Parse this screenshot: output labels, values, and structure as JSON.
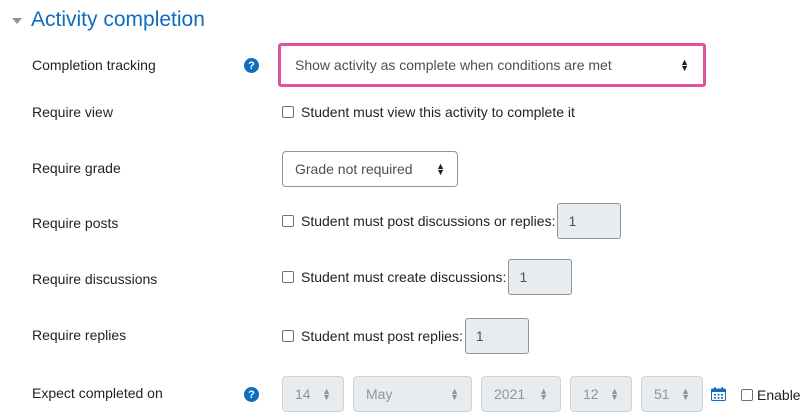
{
  "section": {
    "title": "Activity completion"
  },
  "completion_tracking": {
    "label": "Completion tracking",
    "value": "Show activity as complete when conditions are met"
  },
  "require_view": {
    "label": "Require view",
    "checkbox_label": "Student must view this activity to complete it"
  },
  "require_grade": {
    "label": "Require grade",
    "value": "Grade not required"
  },
  "require_posts": {
    "label": "Require posts",
    "checkbox_label": "Student must post discussions or replies:",
    "value": "1"
  },
  "require_discussions": {
    "label": "Require discussions",
    "checkbox_label": "Student must create discussions:",
    "value": "1"
  },
  "require_replies": {
    "label": "Require replies",
    "checkbox_label": "Student must post replies:",
    "value": "1"
  },
  "expect_completed": {
    "label": "Expect completed on",
    "day": "14",
    "month": "May",
    "year": "2021",
    "hour": "12",
    "minute": "51",
    "enable_label": "Enable"
  },
  "icons": {
    "help": "question-circle-icon",
    "calendar": "calendar-icon",
    "collapse": "caret-down-icon"
  },
  "colors": {
    "link": "#0f6cbf",
    "highlight": "#e0529e",
    "disabled_bg": "#e9ecef"
  }
}
